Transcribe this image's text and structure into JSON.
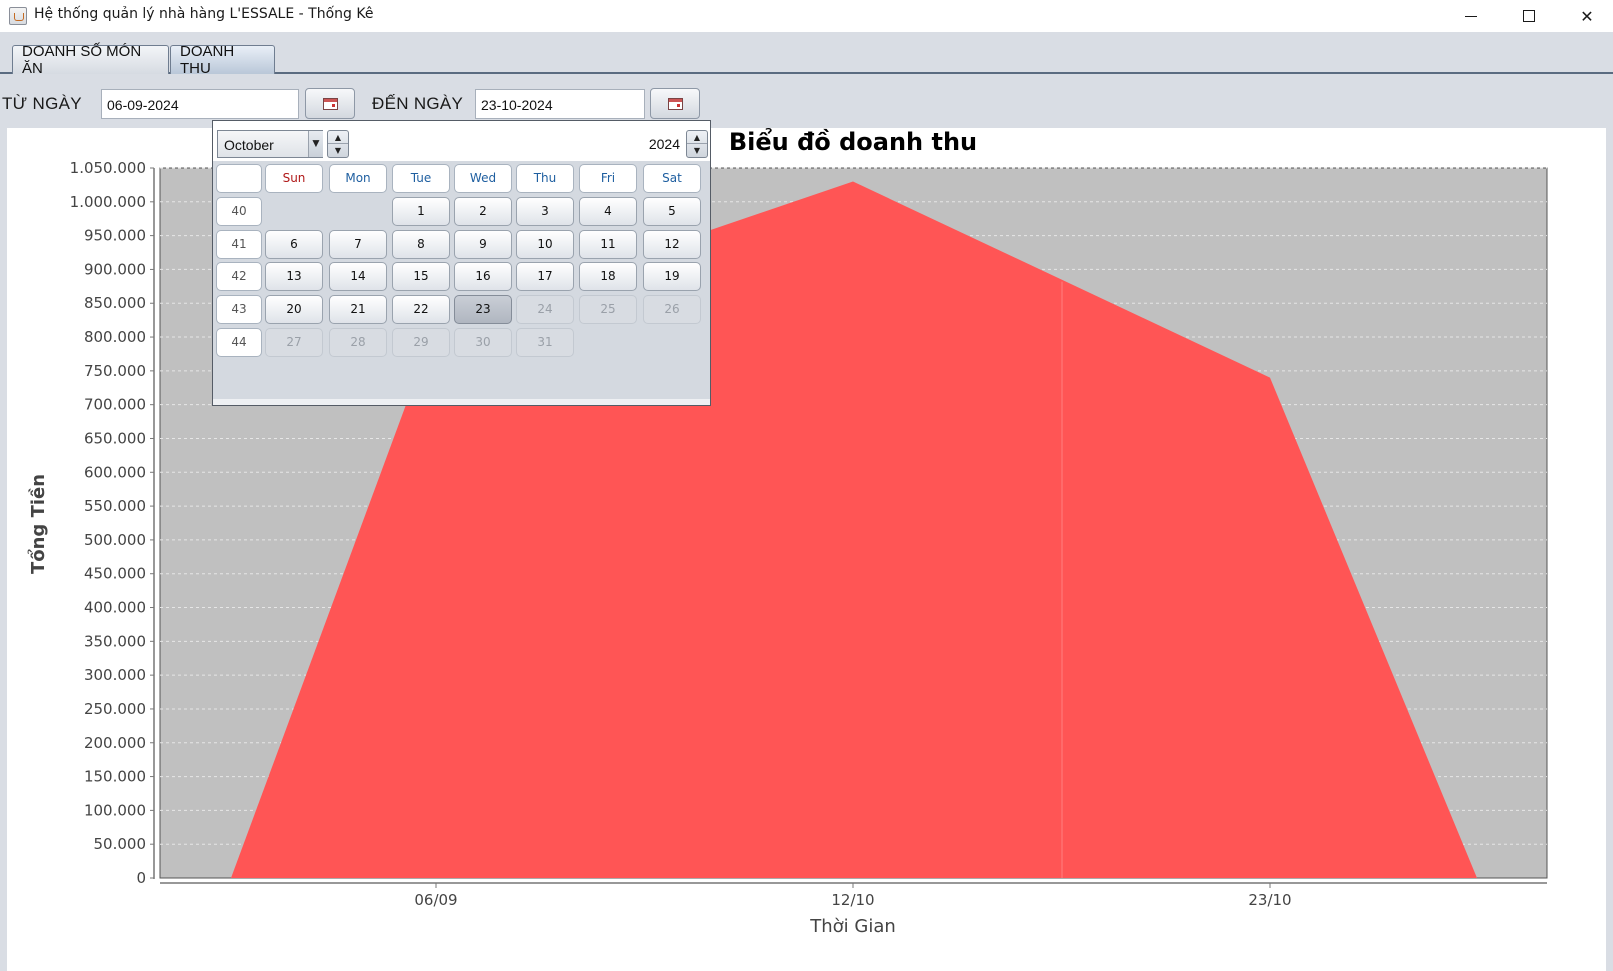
{
  "window": {
    "title": "Hệ thống quản lý nhà hàng L'ESSALE - Thống Kê",
    "minimize_label": "—",
    "maximize_label": "□",
    "close_label": "✕"
  },
  "tabs": [
    {
      "label": "DOANH SỐ MÓN ĂN"
    },
    {
      "label": "DOANH THU"
    }
  ],
  "filter": {
    "from_label": "TỪ NGÀY",
    "from_value": "06-09-2024",
    "to_label": "ĐẾN NGÀY",
    "to_value": "23-10-2024"
  },
  "calendar": {
    "month": "October",
    "year": "2024",
    "weekday_headers": [
      "Sun",
      "Mon",
      "Tue",
      "Wed",
      "Thu",
      "Fri",
      "Sat"
    ],
    "weeks": [
      {
        "week": "40",
        "days": [
          "",
          "",
          "1",
          "2",
          "3",
          "4",
          "5"
        ]
      },
      {
        "week": "41",
        "days": [
          "6",
          "7",
          "8",
          "9",
          "10",
          "11",
          "12"
        ]
      },
      {
        "week": "42",
        "days": [
          "13",
          "14",
          "15",
          "16",
          "17",
          "18",
          "19"
        ]
      },
      {
        "week": "43",
        "days": [
          "20",
          "21",
          "22",
          "23",
          "24",
          "25",
          "26"
        ]
      },
      {
        "week": "44",
        "days": [
          "27",
          "28",
          "29",
          "30",
          "31",
          "",
          ""
        ]
      }
    ],
    "selected_day": "23",
    "last_enabled_day": 23
  },
  "chart_data": {
    "type": "area",
    "title": "Biểu đồ doanh thu",
    "xlabel": "Thời Gian",
    "ylabel": "Tổng Tiền",
    "categories": [
      "06/09",
      "12/10",
      "23/10"
    ],
    "values": [
      820000,
      1030000,
      740000
    ],
    "ylim": [
      0,
      1050000
    ],
    "yticks": [
      "0",
      "50.000",
      "100.000",
      "150.000",
      "200.000",
      "250.000",
      "300.000",
      "350.000",
      "400.000",
      "450.000",
      "500.000",
      "550.000",
      "600.000",
      "650.000",
      "700.000",
      "750.000",
      "800.000",
      "850.000",
      "900.000",
      "950.000",
      "1.000.000",
      "1.050.000"
    ],
    "grid": true,
    "colors": {
      "area": "#ff5555",
      "plot_bg": "#c0c0c0",
      "grid": "#e6e6e6"
    }
  }
}
